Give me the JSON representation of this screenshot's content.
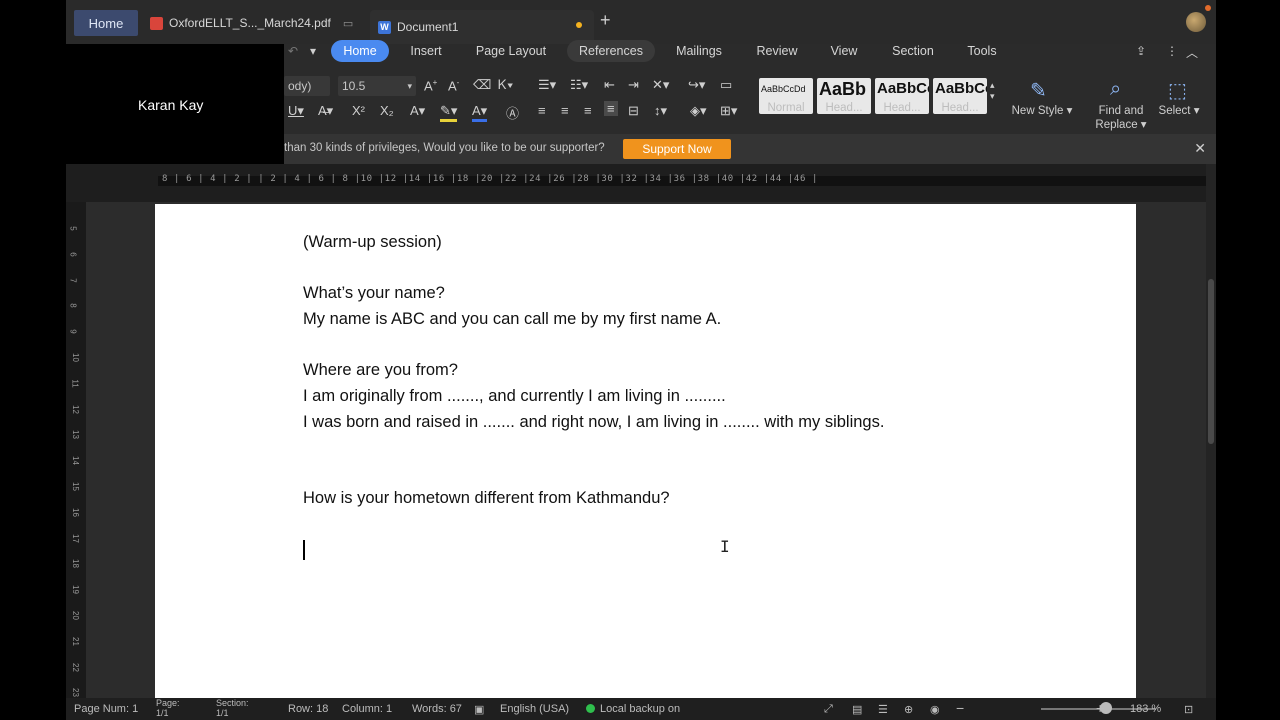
{
  "tabs": {
    "home": "Home",
    "pdf": "OxfordELLT_S..._March24.pdf",
    "document": "Document1"
  },
  "participant": {
    "name": "Karan Kay"
  },
  "menu": {
    "home": "Home",
    "insert": "Insert",
    "page_layout": "Page Layout",
    "references": "References",
    "mailings": "Mailings",
    "review": "Review",
    "view": "View",
    "section": "Section",
    "tools": "Tools"
  },
  "font": {
    "family": "ody)",
    "size": "10.5"
  },
  "styles": [
    {
      "sample": "AaBbCcDd",
      "label": "Normal"
    },
    {
      "sample": "AaBb",
      "label": "Head..."
    },
    {
      "sample": "AaBbCc",
      "label": "Head..."
    },
    {
      "sample": "AaBbCc",
      "label": "Head..."
    }
  ],
  "ribbon_buttons": {
    "new_style": "New Style",
    "find_replace_1": "Find and",
    "find_replace_2": "Replace",
    "select": "Select"
  },
  "notification": {
    "text": "than 30 kinds of privileges, Would you like to be our supporter?",
    "button": "Support Now"
  },
  "ruler": {
    "numbers": "8 | 6 | 4 | 2 |   | 2 | 4 | 6 | 8 |10 |12 |14 |16 |18 |20 |22 |24 |26 |28 |30 |32 |34 |36 |38 |40 |42 |44 |46 |"
  },
  "vruler": [
    "5",
    "6",
    "7",
    "8",
    "9",
    "10",
    "11",
    "12",
    "13",
    "14",
    "15",
    "16",
    "17",
    "18",
    "19",
    "20",
    "21",
    "22",
    "23"
  ],
  "document": {
    "lines": [
      "(Warm-up session)",
      "What’s your name?",
      "My name is ABC and you can call me by my first name A.",
      "Where are you from?",
      "I am originally from ......., and currently I am living in .........",
      "I was born and raised in ....... and right now, I am living in ........ with my siblings.",
      "How is your hometown different from Kathmandu?"
    ]
  },
  "status": {
    "page_num": "Page Num: 1",
    "page_label": "Page:",
    "page_val": "1/1",
    "section_label": "Section:",
    "section_val": "1/1",
    "row": "Row: 18",
    "column": "Column: 1",
    "words": "Words: 67",
    "language": "English (USA)",
    "backup": "Local backup on",
    "zoom": "183 %"
  }
}
